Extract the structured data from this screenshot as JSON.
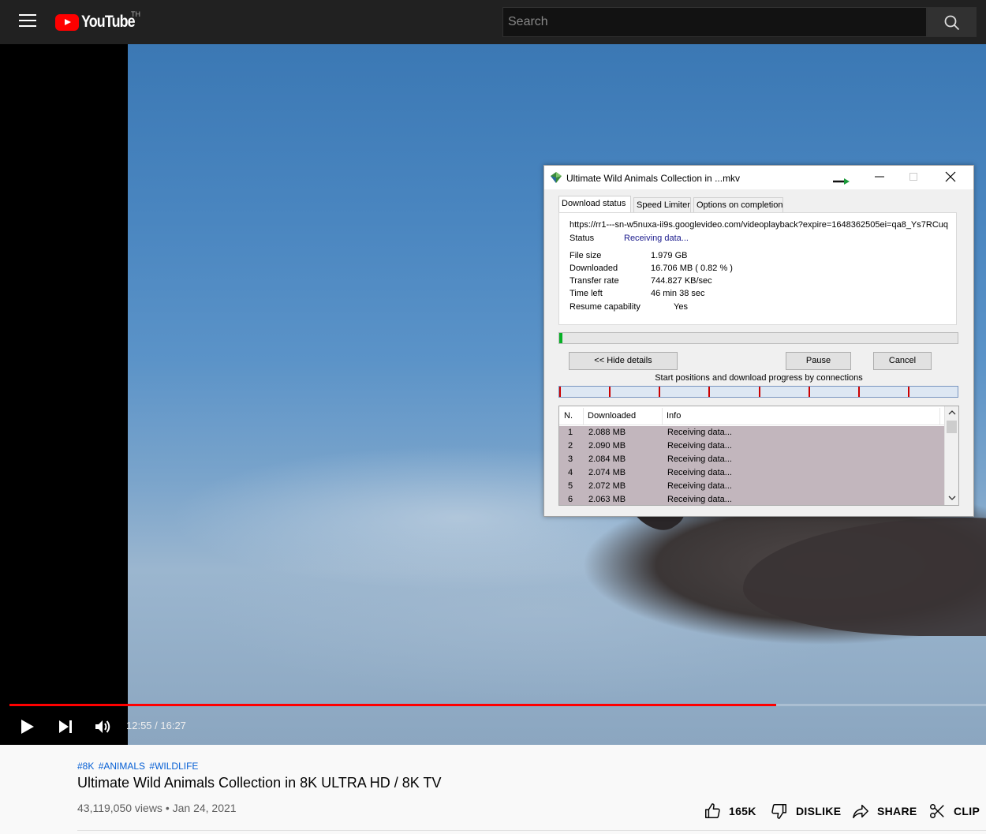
{
  "masthead": {
    "logo_text": "YouTube",
    "country_code": "TH",
    "search_placeholder": "Search"
  },
  "player": {
    "time_current": "12:55",
    "time_total": "16:27",
    "time_display": "12:55 / 16:27",
    "progress_fraction": 0.785
  },
  "download_dialog": {
    "title": "Ultimate Wild Animals Collection in ...mkv",
    "tabs": [
      "Download status",
      "Speed Limiter",
      "Options on completion"
    ],
    "active_tab": "Download status",
    "url": "https://rr1---sn-w5nuxa-ii9s.googlevideo.com/videoplayback?expire=1648362505ei=qa8_Ys7RCuq",
    "status_label": "Status",
    "status_value": "Receiving data...",
    "file_size_label": "File size",
    "file_size_value": "1.979  GB",
    "downloaded_label": "Downloaded",
    "downloaded_value": "16.706  MB  ( 0.82 % )",
    "transfer_rate_label": "Transfer rate",
    "transfer_rate_value": "744.827  KB/sec",
    "time_left_label": "Time left",
    "time_left_value": "46 min 38 sec",
    "resume_label": "Resume capability",
    "resume_value": "Yes",
    "overall_progress_fraction": 0.0082,
    "hide_details_label": "<< Hide details",
    "pause_label": "Pause",
    "cancel_label": "Cancel",
    "connections_caption": "Start positions and download progress by connections",
    "connection_count": 8,
    "list_headers": [
      "N.",
      "Downloaded",
      "Info"
    ],
    "connections": [
      {
        "n": "1",
        "downloaded": "2.088  MB",
        "info": "Receiving data..."
      },
      {
        "n": "2",
        "downloaded": "2.090  MB",
        "info": "Receiving data..."
      },
      {
        "n": "3",
        "downloaded": "2.084  MB",
        "info": "Receiving data..."
      },
      {
        "n": "4",
        "downloaded": "2.074  MB",
        "info": "Receiving data..."
      },
      {
        "n": "5",
        "downloaded": "2.072  MB",
        "info": "Receiving data..."
      },
      {
        "n": "6",
        "downloaded": "2.063  MB",
        "info": "Receiving data..."
      }
    ]
  },
  "video": {
    "hashtags": [
      "#8K",
      "#ANIMALS",
      "#WILDLIFE"
    ],
    "title": "Ultimate Wild Animals Collection in 8K ULTRA HD / 8K TV",
    "meta": "43,119,050 views • Jan 24, 2021",
    "like_count": "165K",
    "dislike_label": "DISLIKE",
    "share_label": "SHARE",
    "clip_label": "CLIP"
  },
  "colors": {
    "brand_red": "#ff0000",
    "masthead_bg": "#212121",
    "link_blue": "#065fd4",
    "row_highlight": "#c2b6bd"
  }
}
